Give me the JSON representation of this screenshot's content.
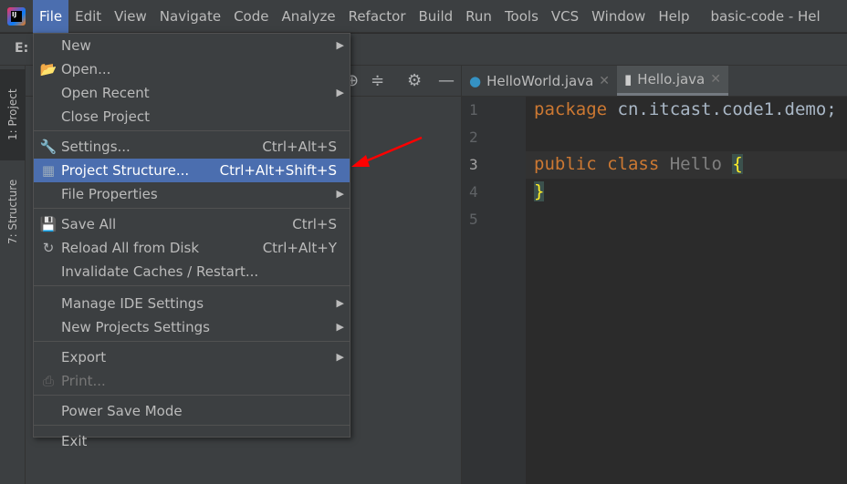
{
  "menubar": {
    "items": [
      "File",
      "Edit",
      "View",
      "Navigate",
      "Code",
      "Analyze",
      "Refactor",
      "Build",
      "Run",
      "Tools",
      "VCS",
      "Window",
      "Help"
    ],
    "title": "basic-code - Hel"
  },
  "navbar": {
    "crumb": "E:"
  },
  "toolwindows": {
    "project": "1: Project",
    "structure": "7: Structure"
  },
  "tabs": [
    {
      "label": "HelloWorld.java"
    },
    {
      "label": "Hello.java",
      "selected": true
    }
  ],
  "editor": {
    "lines": [
      "1",
      "2",
      "3",
      "4",
      "5"
    ],
    "code": {
      "l1_kw": "package",
      "l1_rest": " cn.itcast.code1.demo;",
      "l3_kw": "public class",
      "l3_name": " Hello ",
      "brace_open": "{",
      "brace_close": "}"
    }
  },
  "file_menu": {
    "items": [
      {
        "label": "New",
        "submenu": true
      },
      {
        "label": "Open...",
        "icon": "folder-open-icon"
      },
      {
        "label": "Open Recent",
        "submenu": true
      },
      {
        "label": "Close Project"
      },
      {
        "label": "Settings...",
        "shortcut": "Ctrl+Alt+S",
        "icon": "wrench-icon"
      },
      {
        "label": "Project Structure...",
        "shortcut": "Ctrl+Alt+Shift+S",
        "icon": "project-structure-icon",
        "selected": true
      },
      {
        "label": "File Properties",
        "submenu": true
      },
      {
        "label": "Save All",
        "shortcut": "Ctrl+S",
        "icon": "save-icon"
      },
      {
        "label": "Reload All from Disk",
        "shortcut": "Ctrl+Alt+Y",
        "icon": "reload-icon"
      },
      {
        "label": "Invalidate Caches / Restart..."
      },
      {
        "label": "Manage IDE Settings",
        "submenu": true
      },
      {
        "label": "New Projects Settings",
        "submenu": true
      },
      {
        "label": "Export",
        "submenu": true
      },
      {
        "label": "Print...",
        "icon": "print-icon",
        "disabled": true
      },
      {
        "label": "Power Save Mode"
      },
      {
        "label": "Exit"
      }
    ]
  },
  "colors": {
    "selection": "#4b6eaf",
    "keyword": "#cc7832",
    "annotation_arrow": "#ff0000"
  }
}
